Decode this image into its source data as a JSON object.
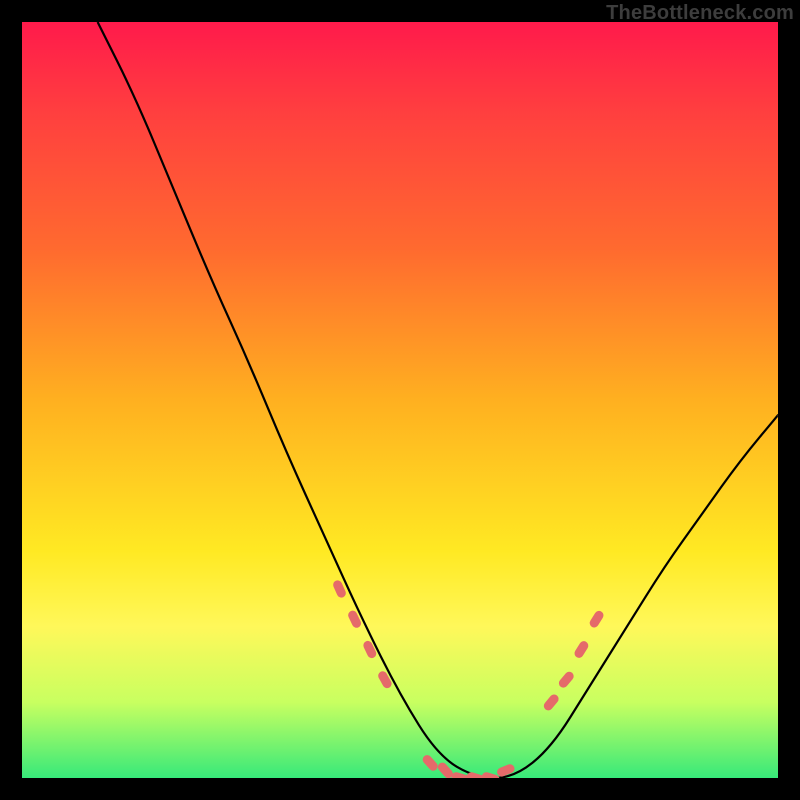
{
  "watermark": "TheBottleneck.com",
  "colors": {
    "background_frame": "#000000",
    "gradient_stops": [
      "#ff1a4b",
      "#ff3f3f",
      "#ff6a2f",
      "#ffb020",
      "#ffe923",
      "#fff85a",
      "#c8ff60",
      "#37e97a"
    ],
    "curve_stroke": "#000000",
    "marker_fill": "#e56a6a"
  },
  "chart_data": {
    "type": "line",
    "title": "",
    "xlabel": "",
    "ylabel": "",
    "xlim": [
      0,
      100
    ],
    "ylim": [
      0,
      100
    ],
    "grid": false,
    "legend": false,
    "description": "Bottleneck curve; y is bottleneck percentage (lower is better), x is relative GPU/CPU power. Valley near x≈55–65 where y≈0.",
    "x": [
      10,
      15,
      20,
      25,
      30,
      35,
      40,
      45,
      50,
      55,
      60,
      65,
      70,
      75,
      80,
      85,
      90,
      95,
      100
    ],
    "y": [
      100,
      90,
      78,
      66,
      55,
      43,
      32,
      21,
      11,
      3,
      0,
      0,
      4,
      12,
      20,
      28,
      35,
      42,
      48
    ],
    "markers": {
      "x": [
        42,
        44,
        46,
        48,
        54,
        56,
        58,
        60,
        62,
        64,
        70,
        72,
        74,
        76
      ],
      "y": [
        25,
        21,
        17,
        13,
        2,
        1,
        0,
        0,
        0,
        1,
        10,
        13,
        17,
        21
      ]
    }
  }
}
